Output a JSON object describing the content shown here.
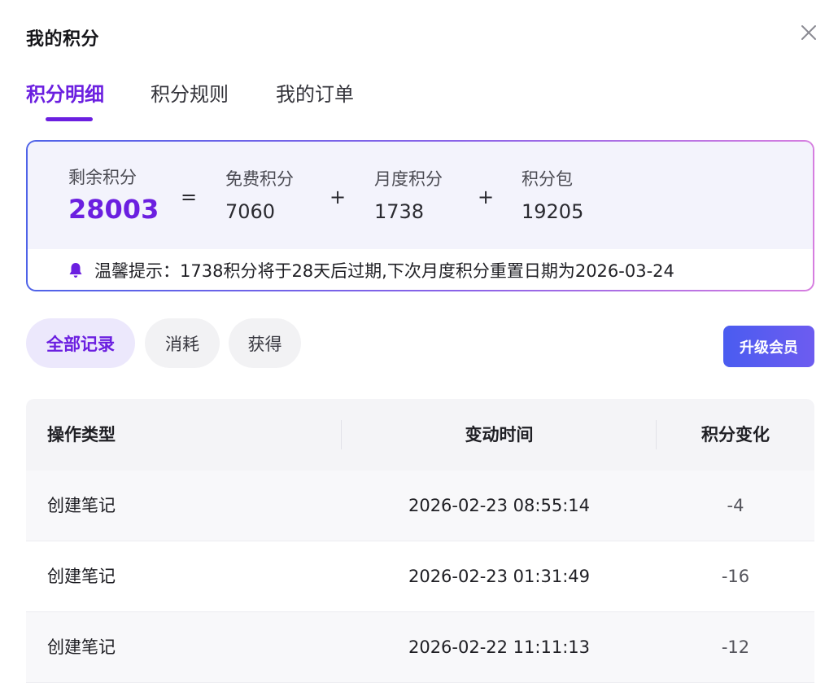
{
  "dialog": {
    "title": "我的积分",
    "close_icon": "close-icon"
  },
  "tabs": [
    {
      "label": "积分明细",
      "active": true
    },
    {
      "label": "积分规则",
      "active": false
    },
    {
      "label": "我的订单",
      "active": false
    }
  ],
  "summary": {
    "remaining": {
      "label": "剩余积分",
      "value": "28003"
    },
    "eq": "=",
    "plus": "+",
    "free": {
      "label": "免费积分",
      "value": "7060"
    },
    "monthly": {
      "label": "月度积分",
      "value": "1738"
    },
    "pack": {
      "label": "积分包",
      "value": "19205"
    },
    "tip_icon": "bell-icon",
    "tip": "温馨提示：1738积分将于28天后过期,下次月度积分重置日期为2026-03-24"
  },
  "filters": [
    {
      "label": "全部记录",
      "active": true
    },
    {
      "label": "消耗",
      "active": false
    },
    {
      "label": "获得",
      "active": false
    }
  ],
  "upgrade_label": "升级会员",
  "table": {
    "headers": [
      "操作类型",
      "变动时间",
      "积分变化"
    ],
    "rows": [
      {
        "type": "创建笔记",
        "time": "2026-02-23 08:55:14",
        "change": "-4"
      },
      {
        "type": "创建笔记",
        "time": "2026-02-23 01:31:49",
        "change": "-16"
      },
      {
        "type": "创建笔记",
        "time": "2026-02-22 11:11:13",
        "change": "-12"
      }
    ]
  },
  "colors": {
    "accent": "#6b1fe0",
    "button": "#4a5cf0"
  }
}
